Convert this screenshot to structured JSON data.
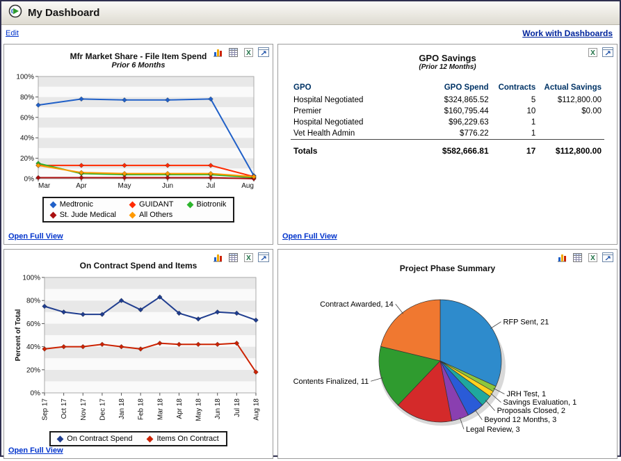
{
  "header": {
    "title": "My Dashboard",
    "edit_link": "Edit",
    "work_with_dashboards_link": "Work with Dashboards"
  },
  "links": {
    "open_full_view": "Open Full View"
  },
  "colors": {
    "link": "#0033cc",
    "table_header_text": "#003366",
    "window_border": "#2f2f4f"
  },
  "toolbar_icons": [
    "column-chart-view",
    "table-view",
    "excel-export",
    "full-view"
  ],
  "chart_data": [
    {
      "id": "mfr-market-share",
      "type": "line",
      "title": "Mfr Market Share - File Item Spend",
      "subtitle": "Prior 6 Months",
      "categories": [
        "Mar",
        "Apr",
        "May",
        "Jun",
        "Jul",
        "Aug"
      ],
      "ylim": [
        0,
        100
      ],
      "ytick_step": 20,
      "y_suffix": "%",
      "grid": "interlaced-bands",
      "legend_position": "bottom",
      "series": [
        {
          "name": "Medtronic",
          "color": "#2060c8",
          "values": [
            72,
            78,
            77,
            77,
            78,
            3
          ]
        },
        {
          "name": "GUIDANT",
          "color": "#ff2a00",
          "values": [
            13,
            13,
            13,
            13,
            13,
            2
          ]
        },
        {
          "name": "Biotronik",
          "color": "#2db52d",
          "values": [
            15,
            5,
            4,
            4,
            4,
            1
          ]
        },
        {
          "name": "St. Jude Medical",
          "color": "#aa0f0f",
          "values": [
            1,
            1,
            1,
            1,
            1,
            0
          ]
        },
        {
          "name": "All Others",
          "color": "#ff9900",
          "values": [
            13,
            6,
            5,
            5,
            5,
            2
          ]
        }
      ]
    },
    {
      "id": "gpo-savings",
      "type": "table",
      "title": "GPO Savings",
      "subtitle": "(Prior 12 Months)",
      "columns": [
        "GPO",
        "GPO Spend",
        "Contracts",
        "Actual Savings"
      ],
      "rows": [
        [
          "Hospital Negotiated",
          "$324,865.52",
          "5",
          "$112,800.00"
        ],
        [
          "Premier",
          "$160,795.44",
          "10",
          "$0.00"
        ],
        [
          "Hospital Negotiated",
          "$96,229.63",
          "1",
          ""
        ],
        [
          "Vet Health Admin",
          "$776.22",
          "1",
          ""
        ]
      ],
      "totals": [
        "Totals",
        "$582,666.81",
        "17",
        "$112,800.00"
      ]
    },
    {
      "id": "on-contract-spend-items",
      "type": "line",
      "title": "On Contract Spend and Items",
      "ylabel": "Percent of Total",
      "categories": [
        "Sep 17",
        "Oct 17",
        "Nov 17",
        "Dec 17",
        "Jan 18",
        "Feb 18",
        "Mar 18",
        "Apr 18",
        "May 18",
        "Jun 18",
        "Jul 18",
        "Aug 18"
      ],
      "ylim": [
        0,
        100
      ],
      "ytick_step": 20,
      "y_suffix": "%",
      "grid": "interlaced-bands",
      "rotate_x_labels": true,
      "legend_position": "bottom",
      "series": [
        {
          "name": "On Contract Spend",
          "color": "#1f3d8f",
          "values": [
            75,
            70,
            68,
            68,
            80,
            72,
            83,
            69,
            64,
            70,
            69,
            63
          ]
        },
        {
          "name": "Items On Contract",
          "color": "#cc2200",
          "values": [
            38,
            40,
            40,
            42,
            40,
            38,
            43,
            42,
            42,
            42,
            43,
            18
          ]
        }
      ]
    },
    {
      "id": "project-phase-summary",
      "type": "pie",
      "title": "Project Phase Summary",
      "slices": [
        {
          "label": "RFP Sent",
          "value": 21,
          "color": "#2e8bcc"
        },
        {
          "label": "JRH Test",
          "value": 1,
          "color": "#8cc63e"
        },
        {
          "label": "Savings Evaluation",
          "value": 1,
          "color": "#ffd21e"
        },
        {
          "label": "Proposals Closed",
          "value": 2,
          "color": "#1fa89e"
        },
        {
          "label": "Beyond 12 Months",
          "value": 3,
          "color": "#2a5bd7"
        },
        {
          "label": "Legal Review",
          "value": 3,
          "color": "#8a3fb0"
        },
        {
          "label": "",
          "value": 10,
          "color": "#d42a2a"
        },
        {
          "label": "Contents Finalized",
          "value": 11,
          "color": "#2f9b2f"
        },
        {
          "label": "Contract Awarded",
          "value": 14,
          "color": "#f07830"
        }
      ]
    }
  ]
}
